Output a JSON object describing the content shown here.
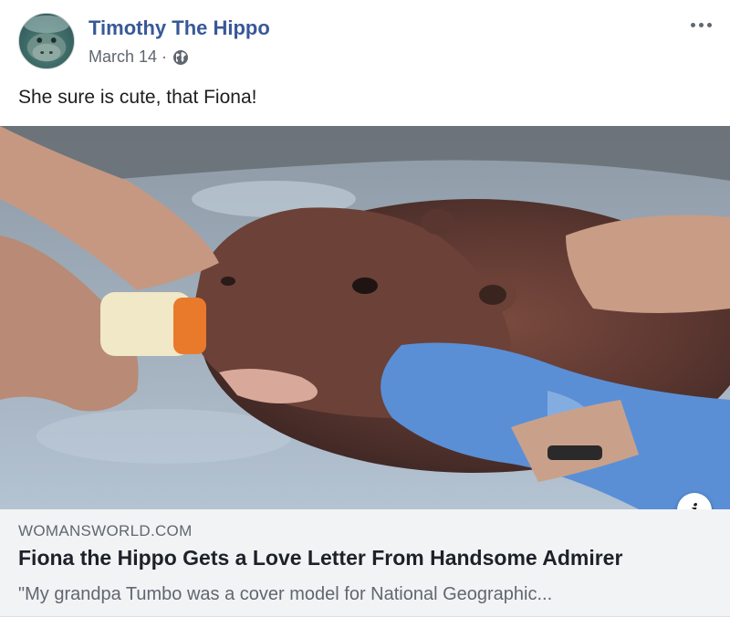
{
  "post": {
    "author": "Timothy The Hippo",
    "date": "March 14",
    "separator": "·",
    "privacy_icon": "globe-icon",
    "text": "She sure is cute, that Fiona!",
    "more_icon": "more-options-icon"
  },
  "link_preview": {
    "domain": "WOMANSWORLD.COM",
    "title": "Fiona the Hippo Gets a Love Letter From Handsome Admirer",
    "description": "\"My grandpa Tumbo was a cover model for National Geographic...",
    "info_icon": "i"
  },
  "colors": {
    "author_link": "#385898",
    "meta_text": "#606770",
    "link_box_bg": "#f2f3f5"
  }
}
